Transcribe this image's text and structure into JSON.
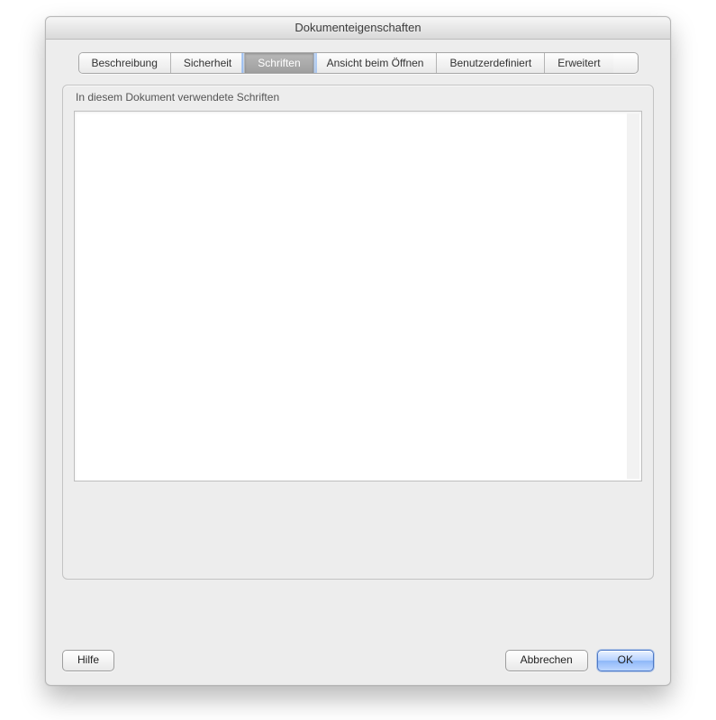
{
  "window": {
    "title": "Dokumenteigenschaften"
  },
  "tabs": {
    "description": "Beschreibung",
    "security": "Sicherheit",
    "fonts": "Schriften",
    "initialView": "Ansicht beim Öffnen",
    "custom": "Benutzerdefiniert",
    "advanced": "Erweitert",
    "active": "fonts"
  },
  "group": {
    "title": "In diesem Dokument verwendete Schriften"
  },
  "buttons": {
    "help": "Hilfe",
    "cancel": "Abbrechen",
    "ok": "OK"
  }
}
